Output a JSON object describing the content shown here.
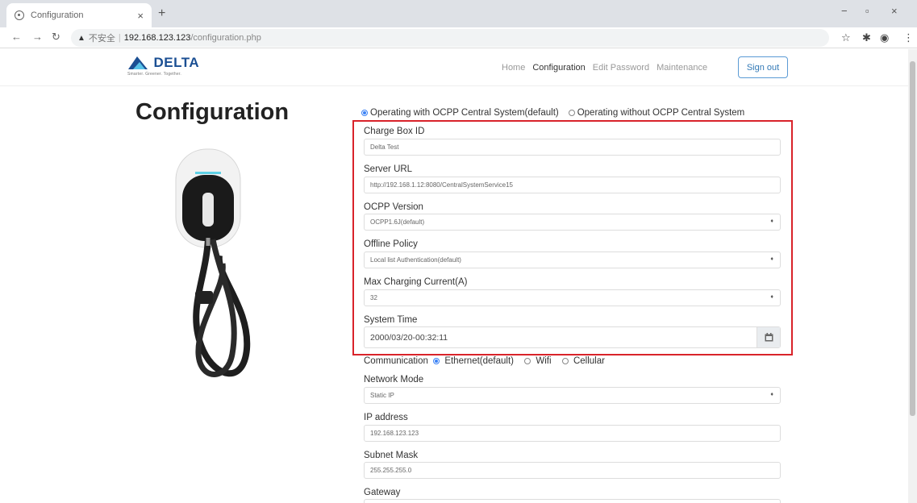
{
  "browser": {
    "tab_title": "Configuration",
    "tab_close": "×",
    "new_tab": "+",
    "address": {
      "warning_glyph": "▲",
      "insecure_label": "不安全",
      "separator": "|",
      "host": "192.168.123.123",
      "path": "/configuration.php"
    },
    "window_controls": [
      "−",
      "▫",
      "×"
    ]
  },
  "header": {
    "logo": {
      "brand": "DELTA",
      "tagline": "Smarter. Greener. Together."
    },
    "menu": [
      {
        "label": "Home",
        "active": false
      },
      {
        "label": "Configuration",
        "active": true
      },
      {
        "label": "Edit Password",
        "active": false
      },
      {
        "label": "Maintenance",
        "active": false
      }
    ],
    "signout_label": "Sign out"
  },
  "page": {
    "title": "Configuration",
    "central_system_options": [
      {
        "label": "Operating with OCPP Central System(default)",
        "selected": true
      },
      {
        "label": "Operating without OCPP Central System",
        "selected": false
      }
    ]
  },
  "form": {
    "charge_box_id": {
      "label": "Charge Box ID",
      "value": "Delta Test"
    },
    "server_url": {
      "label": "Server URL",
      "value": "http://192.168.1.12:8080/CentralSystemService15"
    },
    "ocpp_version": {
      "label": "OCPP Version",
      "value": "OCPP1.6J(default)"
    },
    "offline_policy": {
      "label": "Offline Policy",
      "value": "Local list Authentication(default)"
    },
    "max_current": {
      "label": "Max Charging Current(A)",
      "value": "32"
    },
    "system_time": {
      "label": "System Time",
      "value": "2000/03/20-00:32:11"
    },
    "communication": {
      "label": "Communication",
      "options": [
        {
          "label": "Ethernet(default)",
          "selected": true
        },
        {
          "label": "Wifi",
          "selected": false
        },
        {
          "label": "Cellular",
          "selected": false
        }
      ]
    },
    "network_mode": {
      "label": "Network Mode",
      "value": "Static IP"
    },
    "ip_address": {
      "label": "IP address",
      "value": "192.168.123.123"
    },
    "subnet_mask": {
      "label": "Subnet Mask",
      "value": "255.255.255.0"
    },
    "gateway": {
      "label": "Gateway",
      "value": ""
    }
  },
  "colors": {
    "highlight_box": "#d9232a",
    "brand": "#1b4f93",
    "link": "#337ab7"
  }
}
